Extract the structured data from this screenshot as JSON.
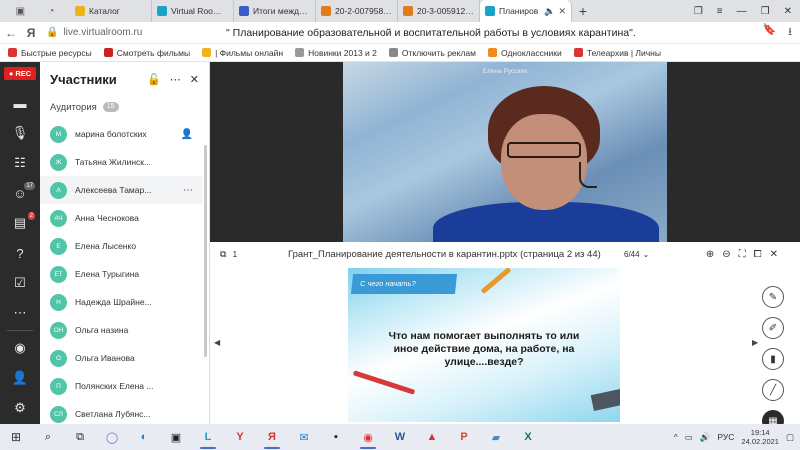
{
  "browser": {
    "tabs": [
      {
        "label": "Каталог",
        "color": "#f0b21a",
        "active": false
      },
      {
        "label": "Virtual Room Live",
        "color": "#1aa3c9",
        "active": false
      },
      {
        "label": "Итоги междисци",
        "color": "#3b5bcc",
        "active": false
      },
      {
        "label": "20-2-007958 - Пр",
        "color": "#e07b1a",
        "active": false
      },
      {
        "label": "20-3-005912 - Пр",
        "color": "#e07b1a",
        "active": false
      },
      {
        "label": "Планиров",
        "color": "#1aa3c9",
        "active": true
      }
    ],
    "address": {
      "url": "live.virtualroom.ru",
      "page_title": "\" Планирование образовательной и воспитательной работы в условиях карантина\"."
    },
    "bookmarks": [
      {
        "label": "Быстрые ресурсы",
        "color": "#d33"
      },
      {
        "label": "Смотреть фильмы",
        "color": "#c22"
      },
      {
        "label": "| Фильмы онлайн",
        "color": "#f0b21a"
      },
      {
        "label": "Новинки 2013 и 2",
        "color": "#999"
      },
      {
        "label": "Отключить реклам",
        "color": "#888"
      },
      {
        "label": "Одноклассники",
        "color": "#f08a1a"
      },
      {
        "label": "Телеархив | Личны",
        "color": "#d33"
      }
    ]
  },
  "rail": {
    "rec_label": "REC",
    "badges": [
      "17",
      "2"
    ]
  },
  "panel": {
    "title": "Участники",
    "audience_label": "Аудитория",
    "audience_count": "15",
    "participants": [
      {
        "initials": "М",
        "name": "марина болотских"
      },
      {
        "initials": "Ж",
        "name": "Татьяна Жилинск..."
      },
      {
        "initials": "А",
        "name": "Алексеева Тамар..."
      },
      {
        "initials": "АЧ",
        "name": "Анна Чеснокова"
      },
      {
        "initials": "Е",
        "name": "Елена Лысенко"
      },
      {
        "initials": "ЕТ",
        "name": "Елена Турыгина"
      },
      {
        "initials": "Н",
        "name": "Надежда Шрайне..."
      },
      {
        "initials": "ОН",
        "name": "Ольга назина"
      },
      {
        "initials": "О",
        "name": "Ольга Иванова"
      },
      {
        "initials": "П",
        "name": "Полянских Елена ..."
      },
      {
        "initials": "СЛ",
        "name": "Светлана Лубянс..."
      }
    ]
  },
  "video": {
    "speaker_name": "Елена Русских"
  },
  "presentation": {
    "slide_number": "1",
    "file_title": "Грант_Планирование деятельности в карантин.pptx (страница 2 из 44)",
    "page_indicator": "6/44",
    "slide": {
      "ribbon_text": "С чего начать?",
      "body_text": "Что нам помогает выполнять то или иное действие дома, на работе, на улице....везде?"
    }
  },
  "taskbar": {
    "language": "РУС",
    "time": "19:14",
    "date": "24.02.2021"
  }
}
